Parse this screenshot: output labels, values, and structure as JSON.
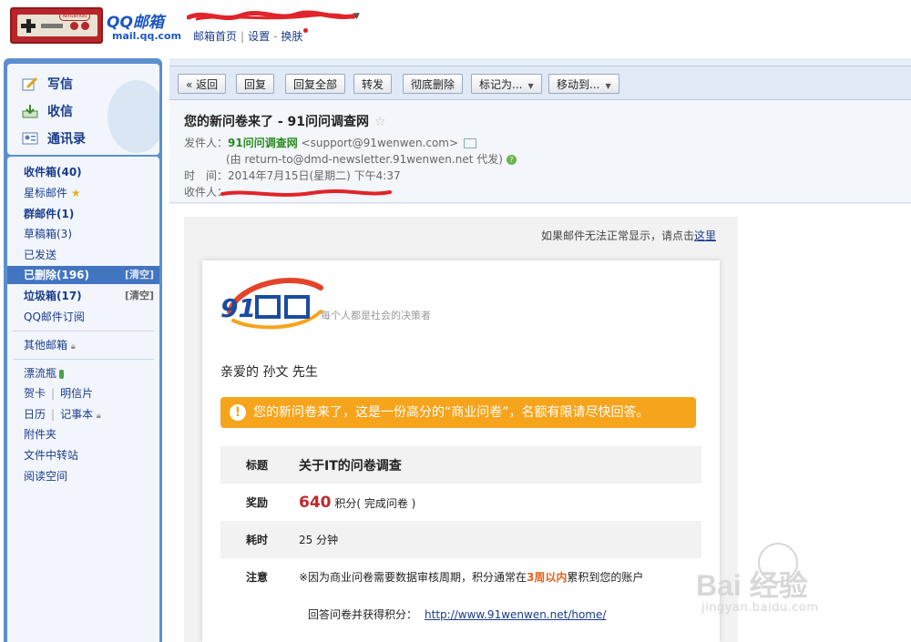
{
  "header": {
    "qq_mail_logo_text": "QQ邮箱",
    "qq_mail_url": "mail.qq.com",
    "console_brand": "Nintendo",
    "nav_home": "邮箱首页",
    "nav_settings": "设置",
    "nav_skin": "换肤"
  },
  "sidebar": {
    "quick": [
      {
        "label": "写信",
        "icon": "compose-icon"
      },
      {
        "label": "收信",
        "icon": "inbox-download-icon"
      },
      {
        "label": "通讯录",
        "icon": "contacts-icon"
      }
    ],
    "folders": {
      "inbox": "收件箱(40)",
      "starred": "星标邮件",
      "group": "群邮件(1)",
      "drafts": "草稿箱(3)",
      "sent": "已发送",
      "deleted": "已删除(196)",
      "deleted_clear": "[清空]",
      "spam": "垃圾箱(17)",
      "spam_clear": "[清空]",
      "subscription": "QQ邮件订阅",
      "other": "其他邮箱",
      "drift_bottle": "漂流瓶",
      "greeting_card": "贺卡",
      "postcard": "明信片",
      "calendar": "日历",
      "notebook": "记事本",
      "attachments": "附件夹",
      "transfer": "文件中转站",
      "reading": "阅读空间"
    }
  },
  "toolbar": {
    "back": "« 返回",
    "reply": "回复",
    "reply_all": "回复全部",
    "forward": "转发",
    "delete_forever": "彻底删除",
    "mark_as": "标记为...",
    "move_to": "移动到..."
  },
  "mail": {
    "subject": "您的新问卷来了 - 91问问调查网",
    "from_label": "发件人：",
    "from_name": "91问问调查网",
    "from_email": "<support@91wenwen.com>",
    "on_behalf": "(由 return-to@dmd-newsletter.91wenwen.net 代发)",
    "time_label": "时　间：",
    "time_value": "2014年7月15日(星期二) 下午4:37",
    "to_label": "收件人："
  },
  "body": {
    "display_issue": "如果邮件无法正常显示，请点击",
    "display_link": "这里",
    "slogan": "每个人都是社会的决策者",
    "greeting": "亲爱的 孙文 先生",
    "notice": "您的新问卷来了，这是一份高分的“商业问卷”，名额有限请尽快回答。",
    "rows": {
      "title_key": "标题",
      "title_value": "关于IT的问卷调查",
      "reward_key": "奖励",
      "reward_num": "640",
      "reward_unit": "积分",
      "reward_note": "( 完成问卷 )",
      "time_key": "耗时",
      "time_value": "25 分钟",
      "note_key": "注意",
      "note_pre": "※因为商业问卷需要数据审核周期，积分通常在",
      "note_hl": "3周以内",
      "note_post": "累积到您的账户"
    },
    "answer_text": "回答问卷并获得积分：",
    "answer_link": "http://www.91wenwen.net/home/"
  },
  "watermark": {
    "text": "Bai 经验",
    "url": "jingyan.baidu.com"
  },
  "colors": {
    "sidebar_blue": "#5b8fcf",
    "selected_folder": "#4275c0",
    "notice_orange": "#f6a41c",
    "reward_red": "#c0282d",
    "sender_green": "#2b8a1e"
  }
}
